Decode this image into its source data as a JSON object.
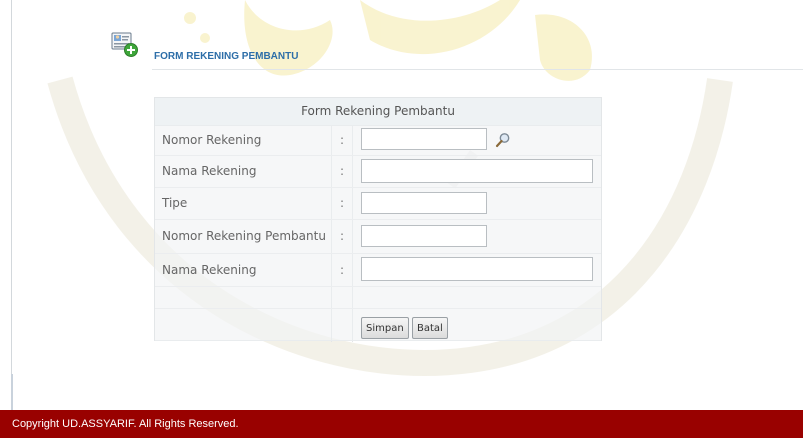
{
  "page": {
    "title": "FORM REKENING PEMBANTU"
  },
  "form": {
    "heading": "Form Rekening Pembantu",
    "colon": ":",
    "fields": [
      {
        "label": "Nomor Rekening",
        "value": ""
      },
      {
        "label": "Nama Rekening",
        "value": ""
      },
      {
        "label": "Tipe",
        "value": ""
      },
      {
        "label": "Nomor Rekening Pembantu",
        "value": ""
      },
      {
        "label": "Nama Rekening",
        "value": ""
      }
    ],
    "save_label": "Simpan",
    "cancel_label": "Batal"
  },
  "footer": {
    "copyright": "Copyright UD.ASSYARIF. All Rights Reserved."
  },
  "icons": {
    "header": "add-record-icon",
    "lookup": "search-icon"
  },
  "colors": {
    "title": "#2d6ea8",
    "footer_bg": "#990100",
    "watermark": "#f3e9a8"
  }
}
